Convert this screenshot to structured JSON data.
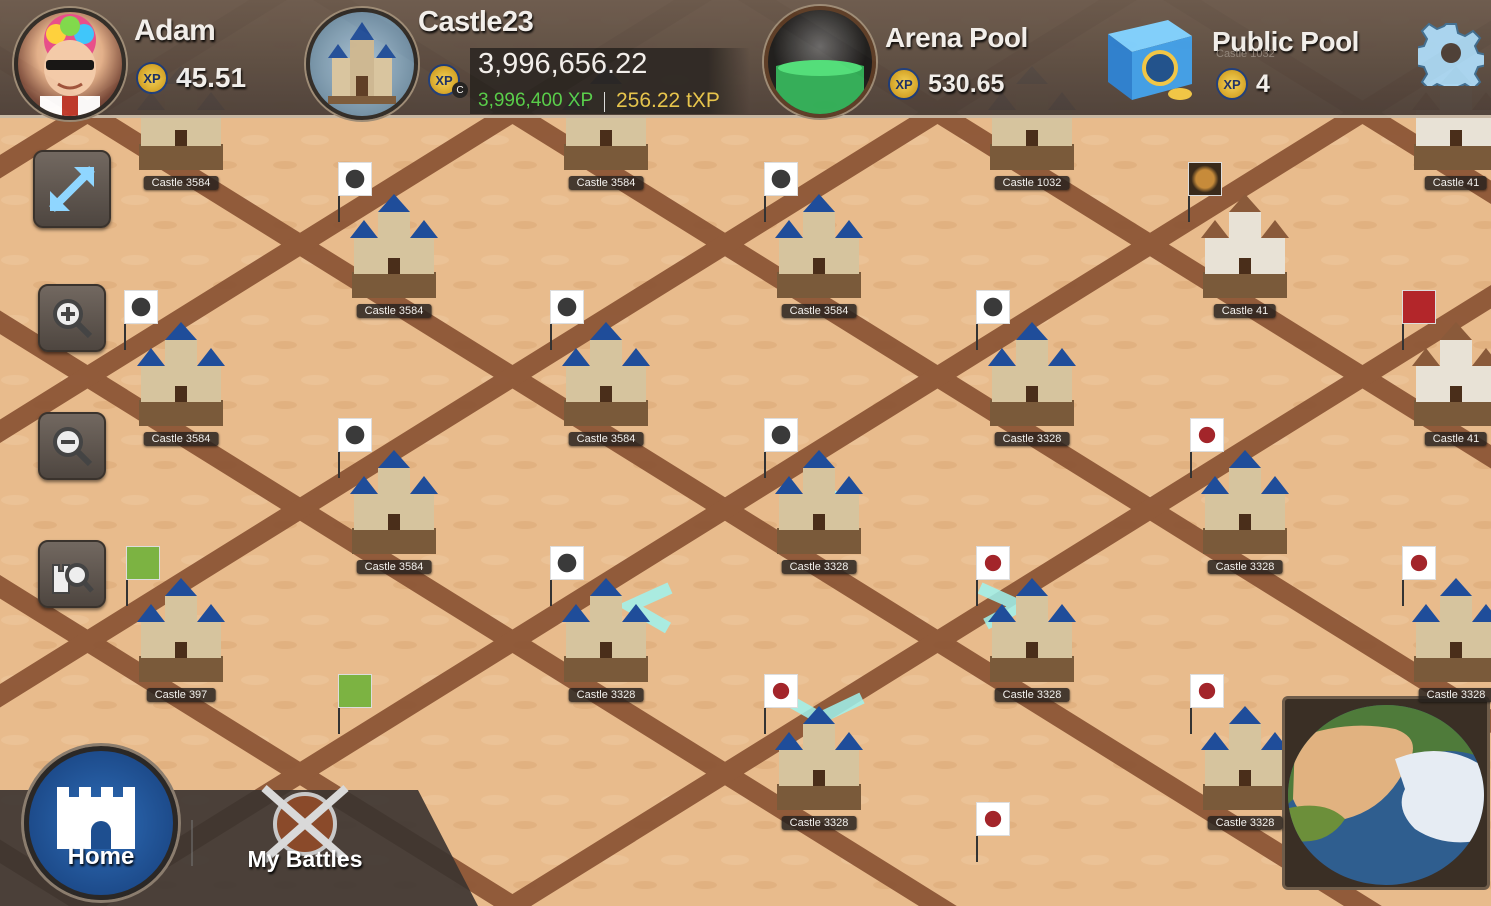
{
  "player": {
    "name": "Adam",
    "xp": "45.51",
    "xp_icon": "xp-coin-icon"
  },
  "castle": {
    "name": "Castle23",
    "balance": "3,996,656.22",
    "xp_amount": "3,996,400 XP",
    "txp_amount": "256.22 tXP"
  },
  "arena_pool": {
    "label": "Arena Pool",
    "value": "530.65"
  },
  "public_pool": {
    "label": "Public Pool",
    "value": "4",
    "ghost_label": "Castle 1032"
  },
  "xp_badge_text": "XP",
  "side_buttons": [
    {
      "name": "fullscreen-button",
      "icon": "expand-arrows-icon"
    },
    {
      "name": "zoom-in-button",
      "icon": "zoom-in-icon"
    },
    {
      "name": "zoom-out-button",
      "icon": "zoom-out-icon"
    },
    {
      "name": "find-castle-button",
      "icon": "castle-search-icon"
    }
  ],
  "bottom_nav": {
    "home_label": "Home",
    "battles_label": "My Battles"
  },
  "map_castles": [
    {
      "label": "Castle 3584"
    },
    {
      "label": "Castle 3584"
    },
    {
      "label": "Castle 1032"
    },
    {
      "label": "Castle 41"
    },
    {
      "label": "Castle 3584"
    },
    {
      "label": "Castle 3584"
    },
    {
      "label": "Castle 41"
    },
    {
      "label": "Castle 3584"
    },
    {
      "label": "Castle 3584"
    },
    {
      "label": "Castle 3328"
    },
    {
      "label": "Castle 41"
    },
    {
      "label": "Castle 3584"
    },
    {
      "label": "Castle 3328"
    },
    {
      "label": "Castle 3328"
    },
    {
      "label": "Castle 397"
    },
    {
      "label": "Castle 3328"
    },
    {
      "label": "Castle 3328"
    },
    {
      "label": "Castle 3328"
    },
    {
      "label": "Castle 3328"
    },
    {
      "label": "Castle 3328"
    }
  ],
  "colors": {
    "sand": "#e6b98a",
    "road": "#8a5334",
    "topbar": "#5a4b40",
    "txp": "#e8c64a",
    "xp_green": "#57d14a",
    "roof_blue": "#1f4d9a"
  }
}
